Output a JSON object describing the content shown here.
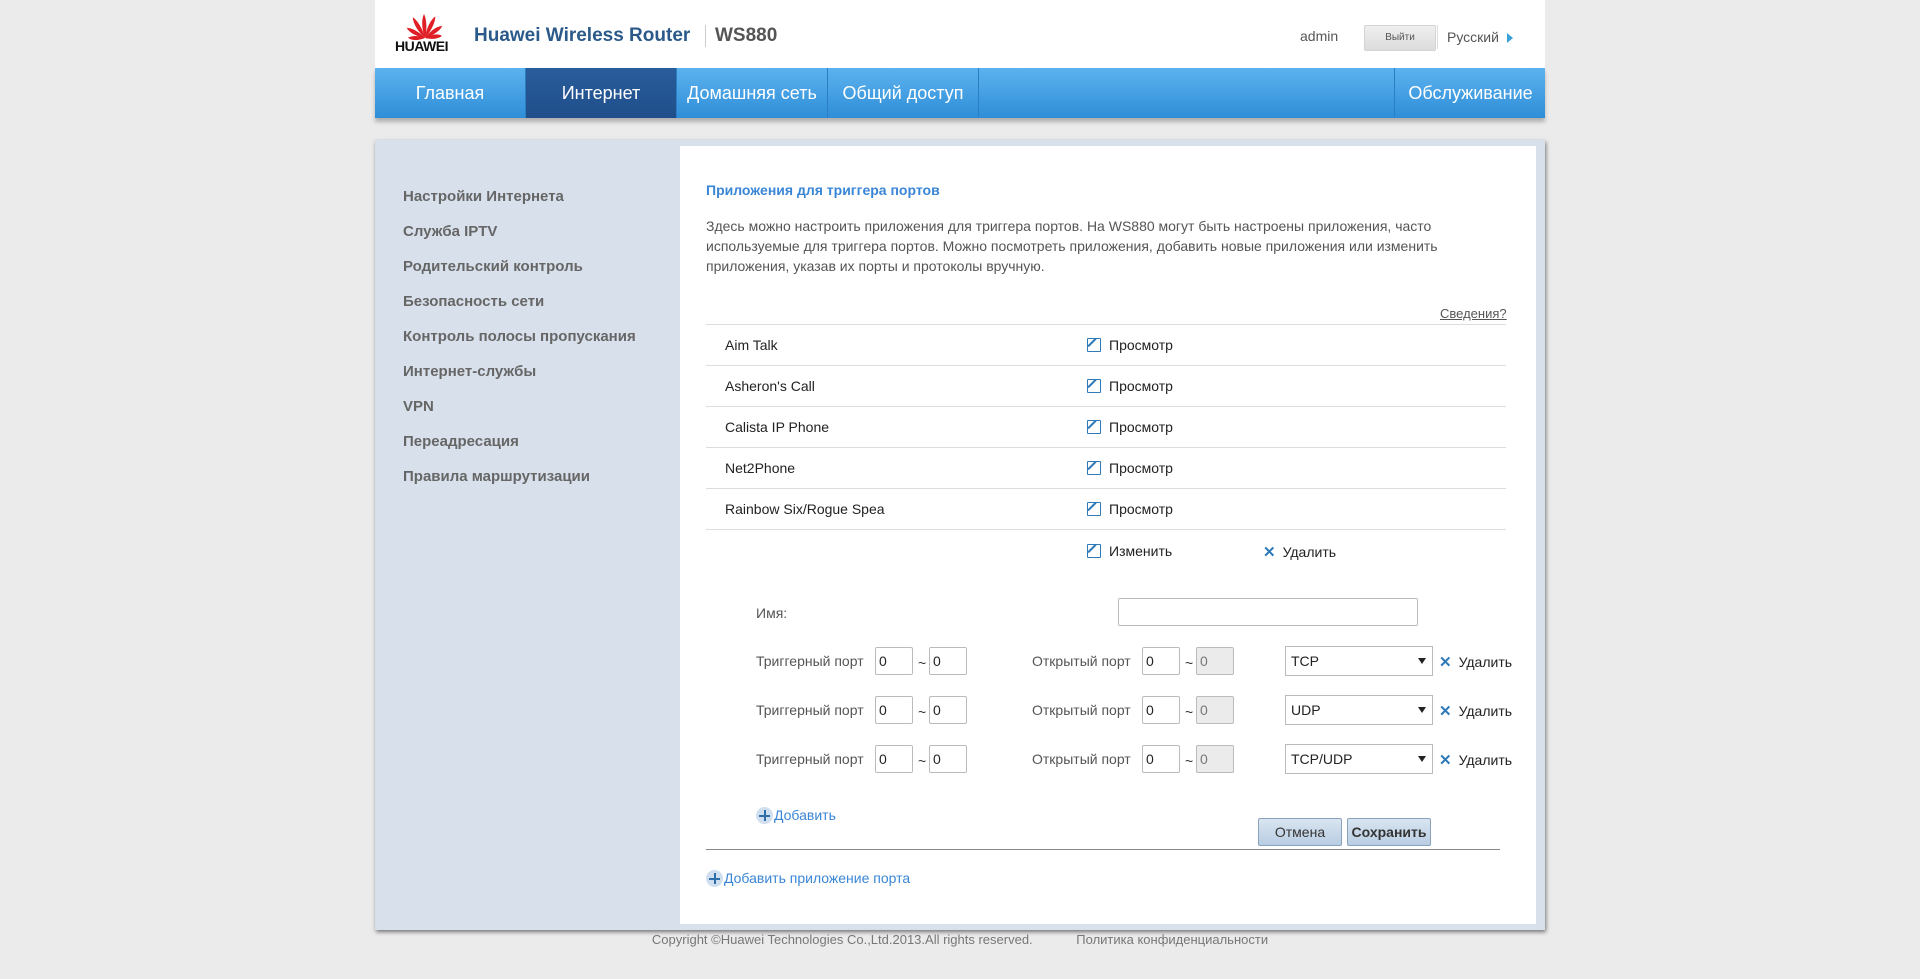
{
  "header": {
    "logo_text": "HUAWEI",
    "app_title": "Huawei Wireless Router",
    "model": "WS880",
    "user": "admin",
    "logout_label": "Выйти",
    "language": "Русский"
  },
  "nav": {
    "items": [
      "Главная",
      "Интернет",
      "Домашняя сеть",
      "Общий доступ"
    ],
    "right_item": "Обслуживание",
    "active": "Интернет"
  },
  "sidebar": {
    "items": [
      "Настройки Интернета",
      "Служба IPTV",
      "Родительский контроль",
      "Безопасность сети",
      "Контроль полосы пропускания",
      "Интернет-службы",
      "VPN",
      "Переадресация",
      "Правила маршрутизации"
    ]
  },
  "main": {
    "title": "Приложения для триггера портов",
    "description": "Здесь можно настроить приложения для триггера портов. На WS880 могут быть настроены приложения, часто используемые для триггера портов. Можно посмотреть приложения, добавить новые приложения или изменить приложения, указав их порты и протоколы вручную.",
    "details_link": "Сведения?",
    "apps": [
      {
        "name": "Aim Talk",
        "action": "Просмотр"
      },
      {
        "name": "Asheron's Call",
        "action": "Просмотр"
      },
      {
        "name": "Calista IP Phone",
        "action": "Просмотр"
      },
      {
        "name": "Net2Phone",
        "action": "Просмотр"
      },
      {
        "name": "Rainbow Six/Rogue Spea",
        "action": "Просмотр"
      }
    ],
    "edit_label": "Изменить",
    "delete_label": "Удалить",
    "form": {
      "name_label": "Имя:",
      "name_value": "",
      "trigger_label": "Триггерный порт",
      "open_label": "Открытый порт",
      "tilde": "~",
      "rows": [
        {
          "trigger_from": "0",
          "trigger_to": "0",
          "open_from": "0",
          "open_to": "0",
          "protocol": "TCP",
          "delete": "Удалить"
        },
        {
          "trigger_from": "0",
          "trigger_to": "0",
          "open_from": "0",
          "open_to": "0",
          "protocol": "UDP",
          "delete": "Удалить"
        },
        {
          "trigger_from": "0",
          "trigger_to": "0",
          "open_from": "0",
          "open_to": "0",
          "protocol": "TCP/UDP",
          "delete": "Удалить"
        }
      ],
      "add_label": "Добавить",
      "cancel_label": "Отмена",
      "save_label": "Сохранить"
    },
    "add_app_label": "Добавить приложение порта"
  },
  "footer": {
    "copyright": "Copyright ©Huawei Technologies Co.,Ltd.2013.All rights reserved.",
    "privacy": "Политика конфиденциальности"
  },
  "colors": {
    "nav_blue": "#3a9be2",
    "nav_active": "#2456934",
    "link_blue": "#3a86d6",
    "brand_red": "#e01e26"
  }
}
